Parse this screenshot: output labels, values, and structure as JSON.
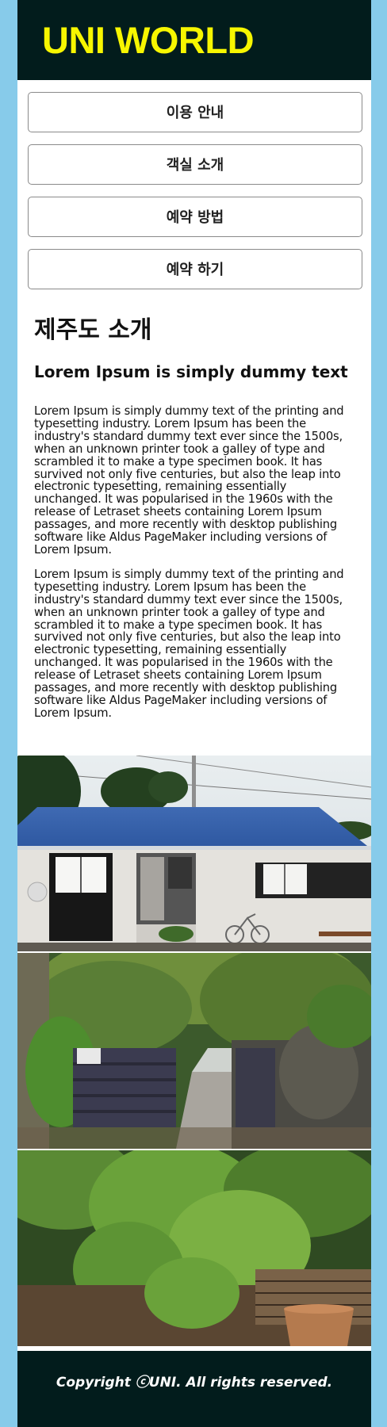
{
  "header": {
    "logo": "UNI WORLD"
  },
  "nav": {
    "items": [
      {
        "label": "이용 안내"
      },
      {
        "label": "객실 소개"
      },
      {
        "label": "예약 방법"
      },
      {
        "label": "예약 하기"
      }
    ]
  },
  "main": {
    "title": "제주도 소개",
    "subtitle": "Lorem Ipsum is simply dummy text",
    "paragraphs": [
      "Lorem Ipsum is simply dummy text of the printing and typesetting industry. Lorem Ipsum has been the industry's standard dummy text ever since the 1500s, when an unknown printer took a galley of type and scrambled it to make a type specimen book. It has survived not only five centuries, but also the leap into electronic typesetting, remaining essentially unchanged. It was popularised in the 1960s with the release of Letraset sheets containing Lorem Ipsum passages, and more recently with desktop publishing software like Aldus PageMaker including versions of Lorem Ipsum.",
      "Lorem Ipsum is simply dummy text of the printing and typesetting industry. Lorem Ipsum has been the industry's standard dummy text ever since the 1500s, when an unknown printer took a galley of type and scrambled it to make a type specimen book. It has survived not only five centuries, but also the leap into electronic typesetting, remaining essentially unchanged. It was popularised in the 1960s with the release of Letraset sheets containing Lorem Ipsum passages, and more recently with desktop publishing software like Aldus PageMaker including versions of Lorem Ipsum."
    ]
  },
  "footer": {
    "copyright": "Copyright ⓒUNI. All rights reserved."
  },
  "colors": {
    "page_background": "#87cbea",
    "header_background": "#021c1c",
    "logo": "#f7f600",
    "footer_text": "#ffffff"
  }
}
